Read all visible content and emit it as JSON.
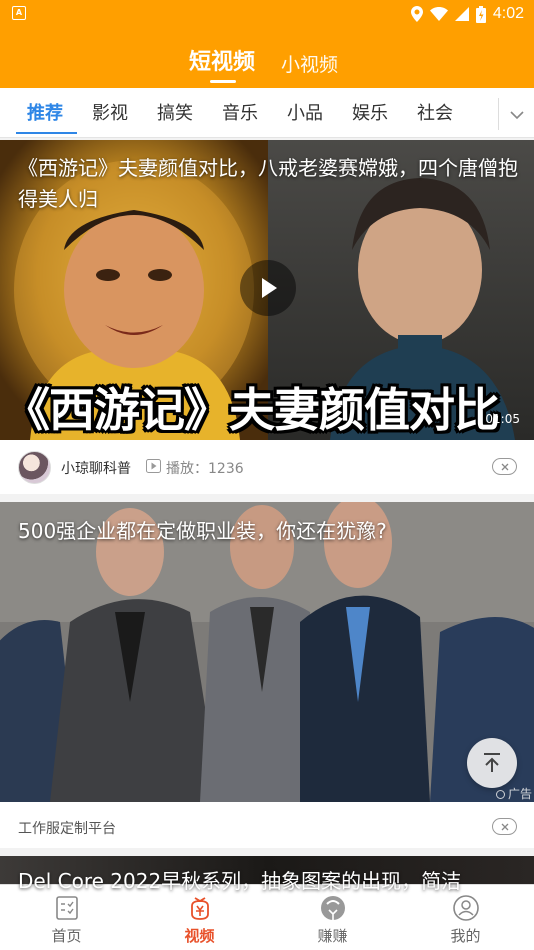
{
  "status_bar": {
    "time": "4:02",
    "app_badge": "A"
  },
  "top_tabs": [
    {
      "label": "短视频",
      "active": true
    },
    {
      "label": "小视频",
      "active": false
    }
  ],
  "categories": [
    {
      "label": "推荐",
      "active": true
    },
    {
      "label": "影视"
    },
    {
      "label": "搞笑"
    },
    {
      "label": "音乐"
    },
    {
      "label": "小品"
    },
    {
      "label": "娱乐"
    },
    {
      "label": "社会"
    }
  ],
  "feed": [
    {
      "title": "《西游记》夫妻颜值对比，八戒老婆赛嫦娥，四个唐僧抱得美人归",
      "caption": "《西游记》夫妻颜值对比",
      "duration": "01:05",
      "author": "小琼聊科普",
      "play_count": "播放：1236"
    },
    {
      "title": "500强企业都在定做职业装，你还在犹豫?",
      "advertiser": "工作服定制平台",
      "ad_label": "广告"
    },
    {
      "title": "Del Core 2022早秋系列，抽象图案的出现，简洁"
    }
  ],
  "bottom_nav": [
    {
      "label": "首页",
      "icon": "home-icon"
    },
    {
      "label": "视频",
      "icon": "video-icon",
      "active": true
    },
    {
      "label": "赚赚",
      "icon": "earn-icon"
    },
    {
      "label": "我的",
      "icon": "profile-icon"
    }
  ],
  "colors": {
    "accent": "#ff9f00",
    "tab_active": "#2e86e6",
    "nav_active": "#e8512a"
  }
}
